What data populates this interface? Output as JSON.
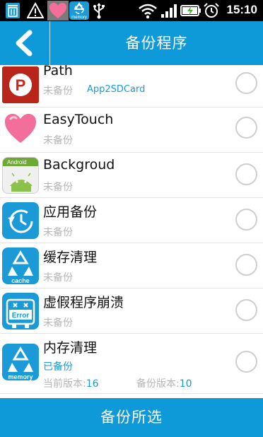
{
  "status_bar": {
    "time": "15:10",
    "icons": [
      "trash-icon",
      "warning-icon",
      "heart-icon",
      "memory-recycle-icon",
      "usb-icon",
      "wifi-icon",
      "signal-icon",
      "battery-charging-icon",
      "alarm-icon"
    ],
    "memory_label": "memory"
  },
  "header": {
    "title": "备份程序",
    "back_icon": "chevron-left-icon"
  },
  "apps": [
    {
      "name": "Path",
      "status": "未备份",
      "extra": "App2SDCard",
      "icon": "path-app-icon",
      "icon_letter": "P"
    },
    {
      "name": "EasyTouch",
      "status": "未备份",
      "icon": "heart-icon"
    },
    {
      "name": "Backgroud",
      "status": "未备份",
      "icon": "android-icon",
      "icon_label": "Android"
    },
    {
      "name": "应用备份",
      "status": "未备份",
      "icon": "history-clock-icon"
    },
    {
      "name": "缓存清理",
      "status": "未备份",
      "icon": "recycle-cache-icon",
      "icon_label": "cache"
    },
    {
      "name": "虚假程序崩溃",
      "status": "未备份",
      "icon": "error-robot-icon",
      "icon_label": "Error"
    },
    {
      "name": "内存清理",
      "status": "已备份",
      "icon": "recycle-memory-icon",
      "icon_label": "memory",
      "current_version_label": "当前版本:",
      "current_version": "16",
      "backup_version_label": "备份版本:",
      "backup_version": "10"
    }
  ],
  "bottom_button": {
    "label": "备份所选"
  },
  "colors": {
    "accent": "#0e9ad8",
    "path_red": "#c8281e",
    "heart_pink": "#f46e9b"
  }
}
